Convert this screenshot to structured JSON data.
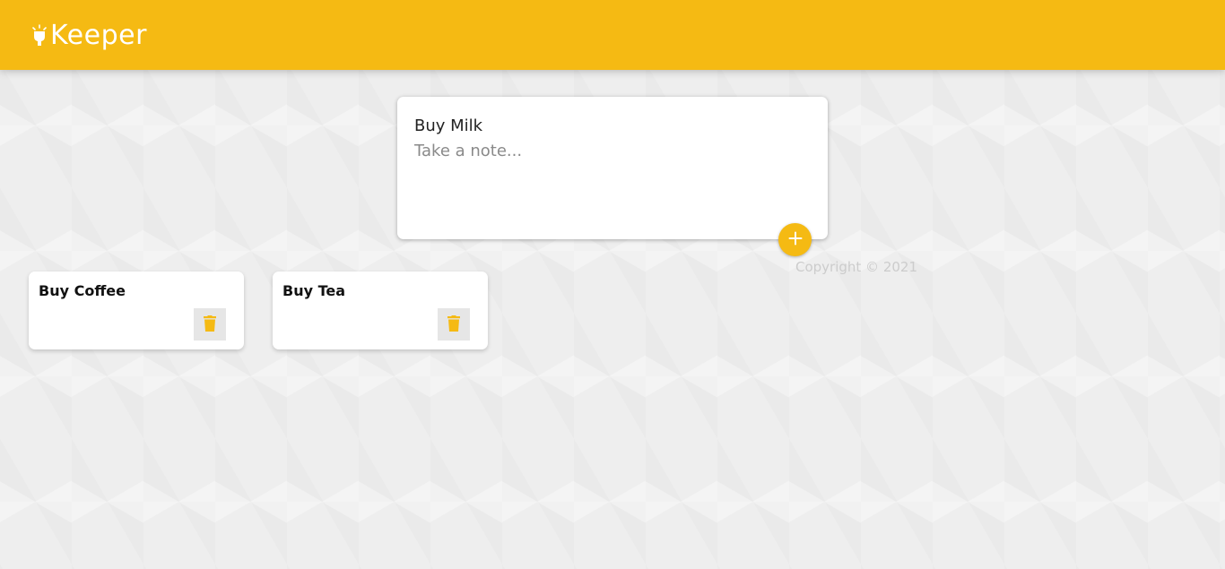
{
  "header": {
    "title": "Keeper",
    "icon": "lightbulb-icon"
  },
  "compose": {
    "title_value": "Buy Milk",
    "content_placeholder": "Take a note...",
    "add_icon": "plus-icon"
  },
  "notes": [
    {
      "title": "Buy Coffee",
      "delete_icon": "trash-icon"
    },
    {
      "title": "Buy Tea",
      "delete_icon": "trash-icon"
    }
  ],
  "footer": {
    "copyright": "Copyright © 2021"
  },
  "colors": {
    "accent": "#f5ba13",
    "background": "#eeeeee",
    "card": "#ffffff"
  }
}
